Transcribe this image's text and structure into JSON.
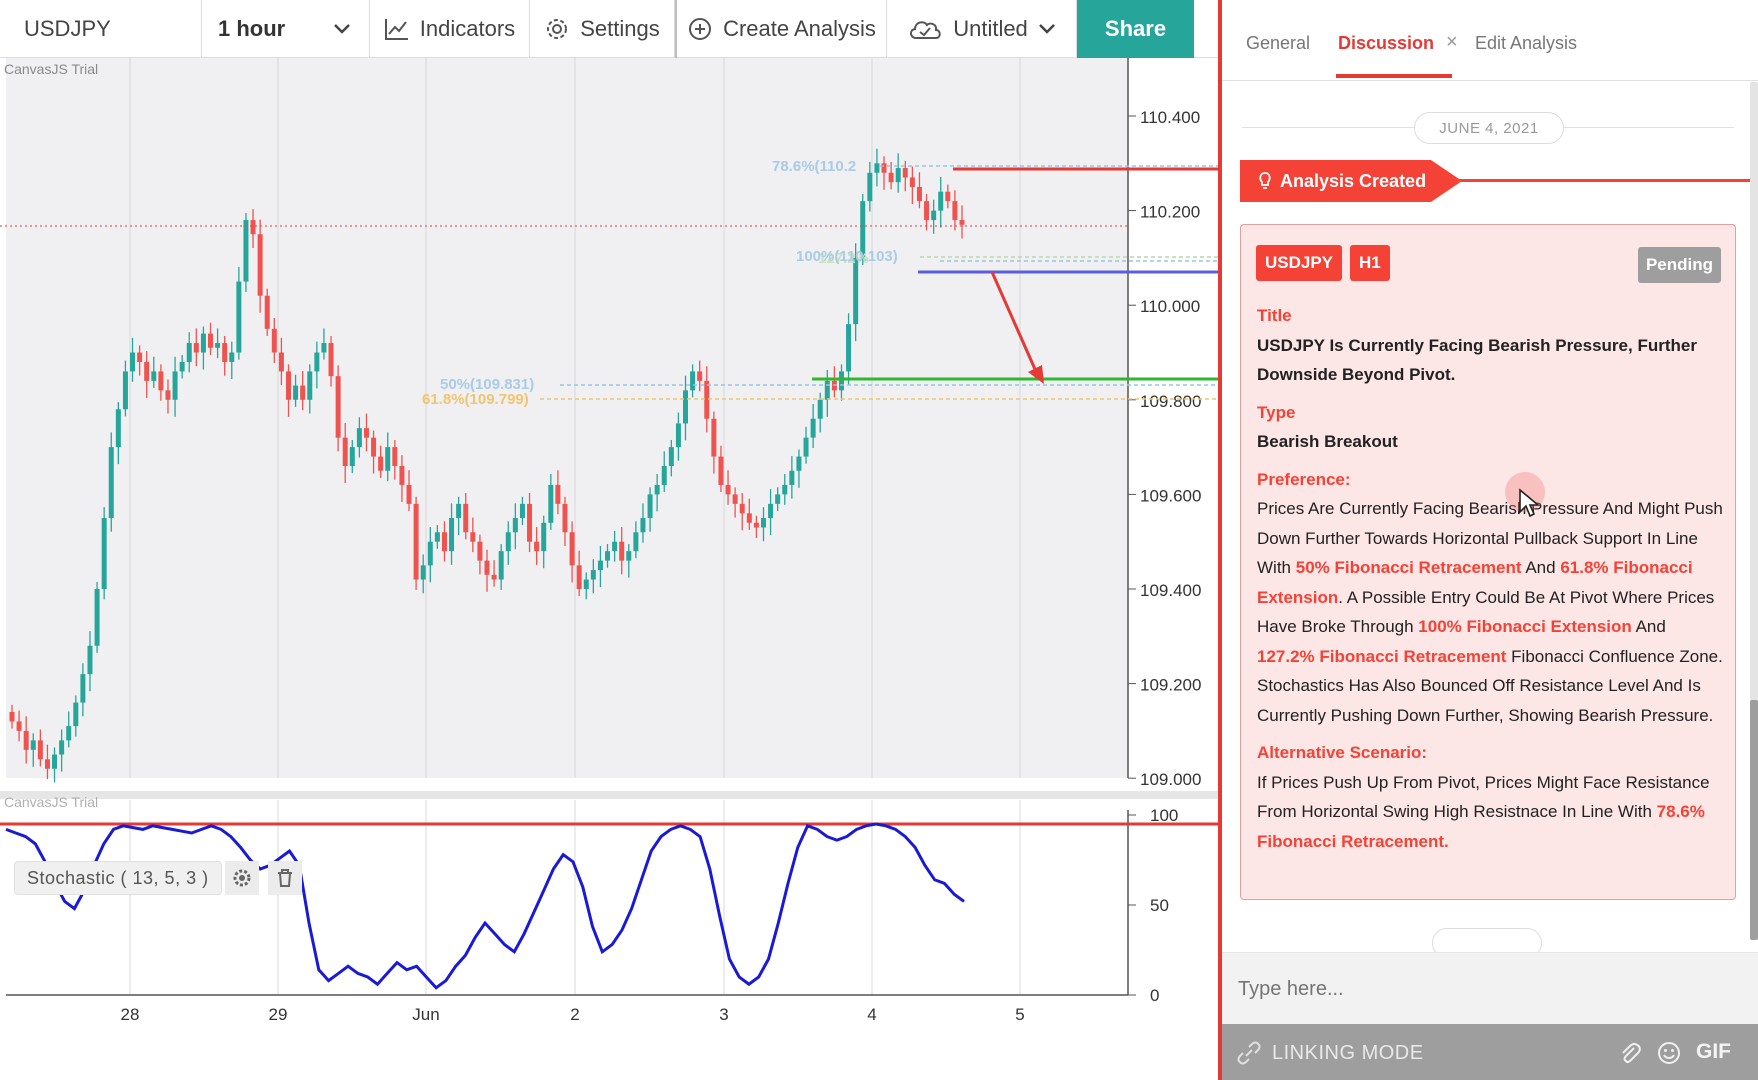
{
  "toolbar": {
    "symbol": "USDJPY",
    "interval": "1 hour",
    "indicators": "Indicators",
    "settings": "Settings",
    "create_analysis": "Create Analysis",
    "untitled": "Untitled",
    "share": "Share"
  },
  "chart": {
    "trial_label_top": "CanvasJS Trial",
    "trial_label_bottom": "CanvasJS Trial",
    "stochastic_label": "Stochastic ( 13, 5, 3 )",
    "price_ticks": [
      "110.400",
      "110.200",
      "110.000",
      "109.800",
      "109.600",
      "109.400",
      "109.200",
      "109.000"
    ],
    "stoch_ticks": [
      "100",
      "50",
      "0"
    ],
    "x_ticks": [
      "28",
      "29",
      "Jun",
      "2",
      "3",
      "4",
      "5"
    ],
    "fib_labels": {
      "fib786": "78.6%(110.2",
      "fib100": "100%(110.103)",
      "fib1272": "127.2%",
      "fib50": "50%(109.831)",
      "fib618": "61.8%(109.799)"
    },
    "colors": {
      "bull": "#26a69a",
      "bear": "#ef5350",
      "stoch": "#1a1ad6",
      "resistance": "#e53935",
      "pivot": "#5c5ce0",
      "support": "#2eb82e"
    }
  },
  "panel": {
    "tabs": {
      "general": "General",
      "discussion": "Discussion",
      "close": "×",
      "edit": "Edit Analysis"
    },
    "date": "JUNE 4, 2021",
    "analysis_created": "Analysis Created",
    "card": {
      "symbol_badge": "USDJPY",
      "timeframe_badge": "H1",
      "status_badge": "Pending",
      "title_label": "Title",
      "title": "USDJPY Is Currently Facing Bearish Pressure, Further Downside Beyond Pivot.",
      "type_label": "Type",
      "type": "Bearish Breakout",
      "preference_label": "Preference:",
      "pref_1": "Prices Are Currently Facing Bearish Pressure And Might Push Down Further Towards Horizontal Pullback Support In Line With ",
      "pref_hl_1": "50% Fibonacci Retracement",
      "pref_2": " And ",
      "pref_hl_2": "61.8% Fibonacci Extension",
      "pref_3": ". A Possible Entry Could Be At Pivot Where Prices Have Broke Through ",
      "pref_hl_3": "100% Fibonacci Extension",
      "pref_4": " And ",
      "pref_hl_4": "127.2% Fibonacci Retracement",
      "pref_5": " Fibonacci Confluence Zone. Stochastics Has Also Bounced Off Resistance Level And Is Currently Pushing Down Further, Showing Bearish Pressure.",
      "alt_label": "Alternative Scenario:",
      "alt_1": "If Prices Push Up From Pivot, Prices Might Face Resistance From Horizontal Swing High Resistnace In Line With ",
      "alt_hl_1": "78.6% Fibonacci Retracement."
    },
    "input_placeholder": "Type here...",
    "linking_mode": "LINKING MODE",
    "gif": "GIF"
  }
}
